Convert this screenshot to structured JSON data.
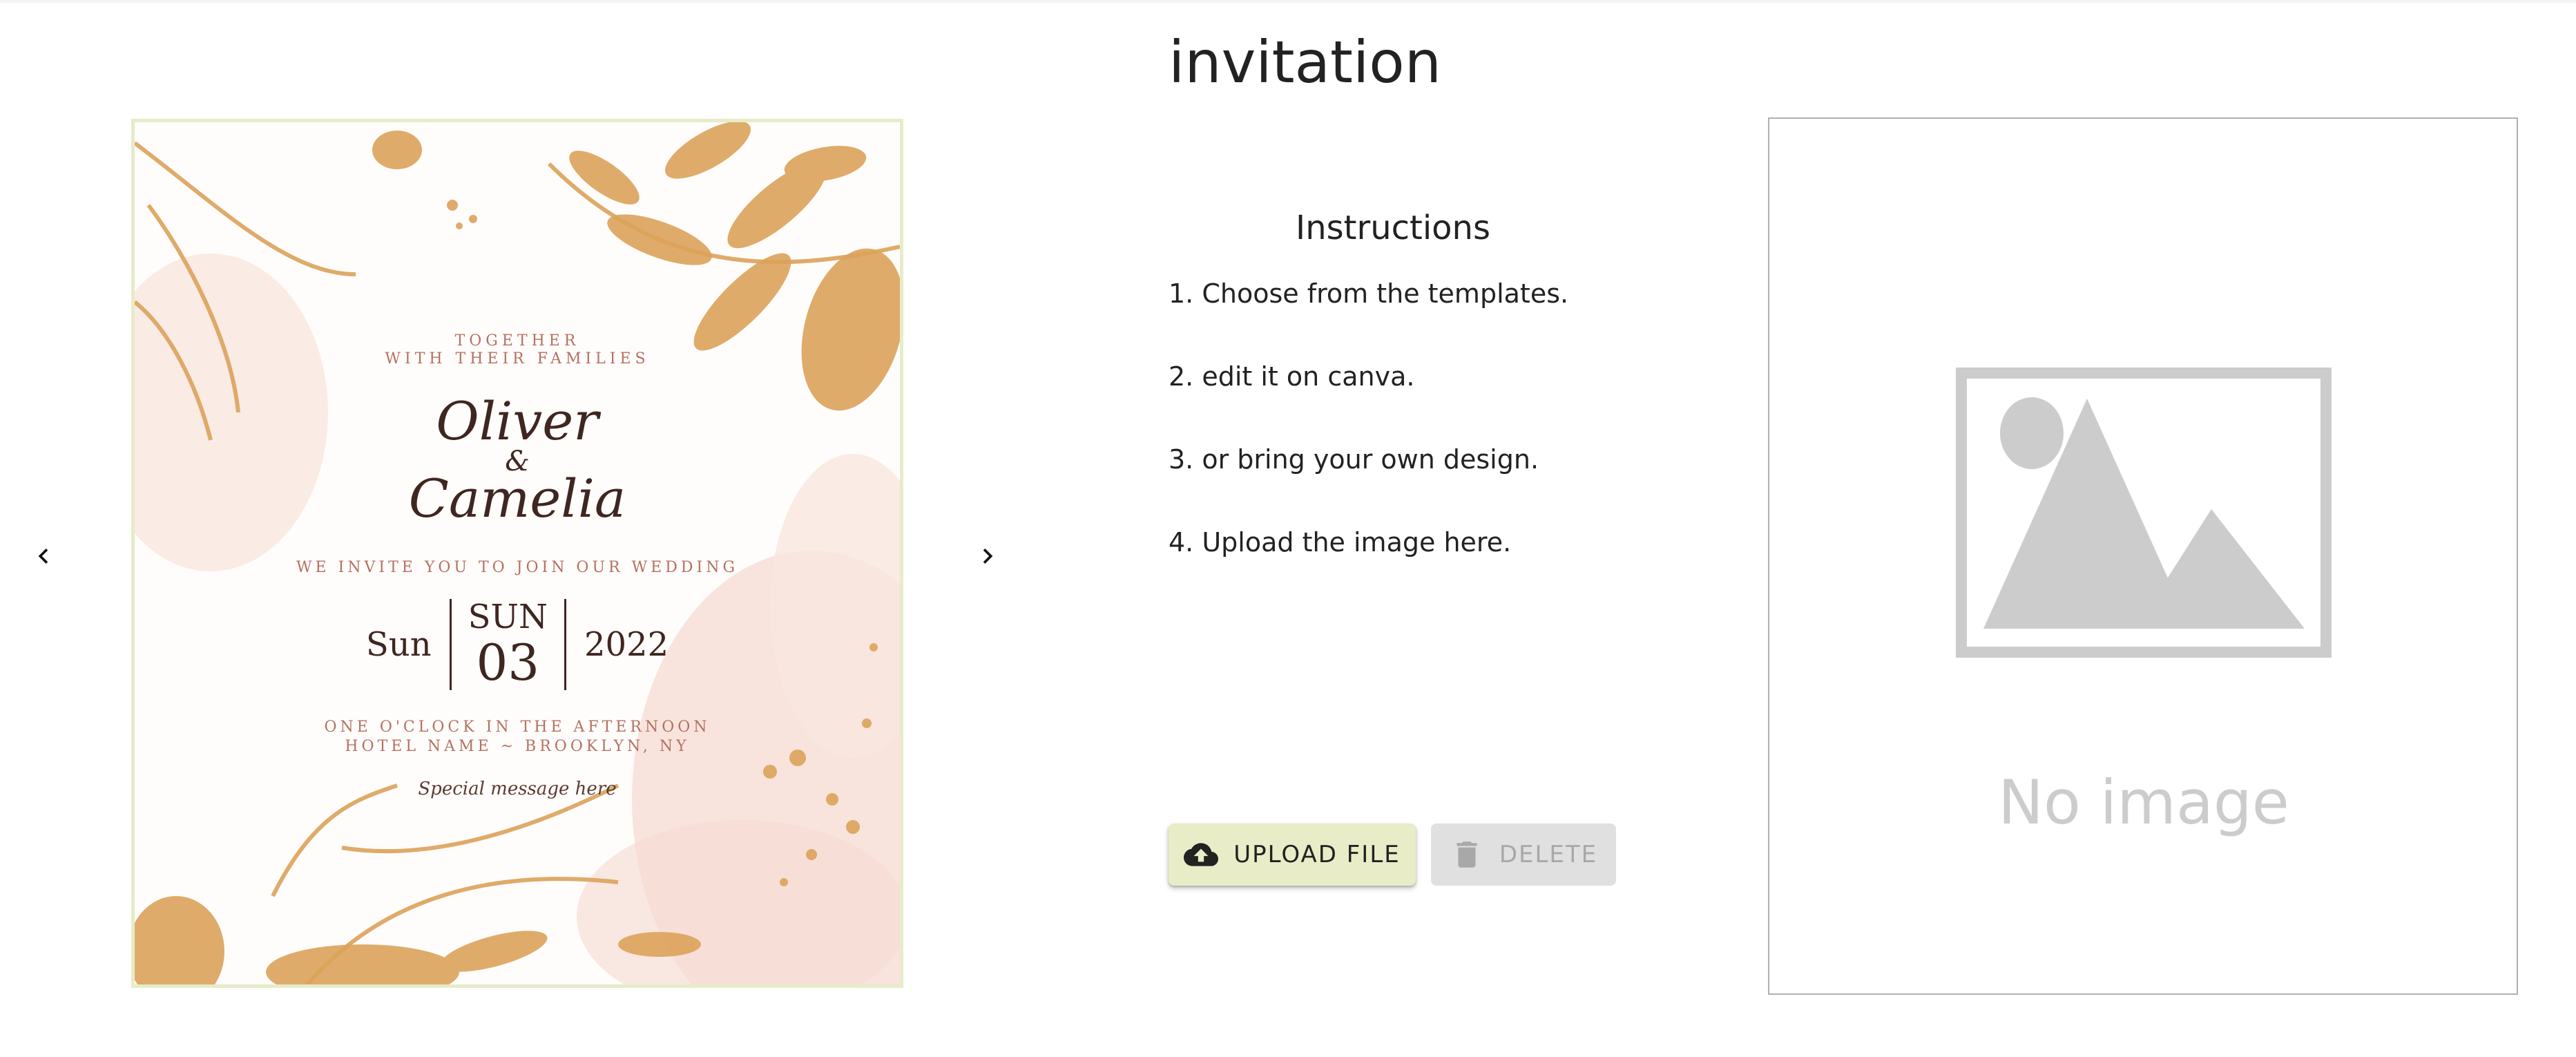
{
  "page": {
    "title": "invitation"
  },
  "carousel": {
    "prev_icon": "chevron-left-icon",
    "next_icon": "chevron-right-icon",
    "template": {
      "together_line1": "TOGETHER",
      "together_line2": "WITH THEIR FAMILIES",
      "name1": "Oliver",
      "ampersand": "&",
      "name2": "Camelia",
      "invite_line": "WE INVITE YOU TO JOIN OUR WEDDING",
      "date_left": "Sun",
      "date_day": "SUN",
      "date_num": "03",
      "date_right": "2022",
      "time_line": "ONE O'CLOCK IN THE AFTERNOON",
      "place_line": "HOTEL NAME ~ BROOKLYN, NY",
      "message": "Special message here",
      "colors": {
        "gold": "#dca25a",
        "blush": "#f6ddd6",
        "text": "#3f2620",
        "accent": "#b57062",
        "border": "#e6ecc8"
      }
    }
  },
  "instructions": {
    "title": "Instructions",
    "steps": [
      "1. Choose from the templates.",
      "2. edit it on canva.",
      "3. or bring your own design.",
      "4. Upload the image here."
    ]
  },
  "actions": {
    "upload_label": "UPLOAD FILE",
    "upload_icon": "cloud-upload-icon",
    "delete_label": "DELETE",
    "delete_icon": "trash-icon"
  },
  "preview": {
    "placeholder_text": "No image",
    "placeholder_icon": "image-placeholder-icon"
  },
  "colors": {
    "upload_bg": "#e9edc7",
    "delete_bg": "#e0e0e0",
    "placeholder_gray": "#cccccc"
  }
}
